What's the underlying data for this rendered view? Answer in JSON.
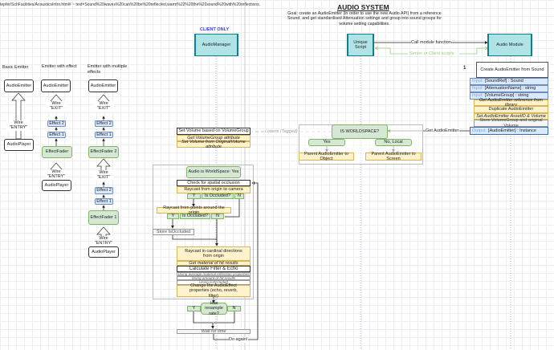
{
  "url_text": "tepfer/SchFacilities/AcousticsIntro.html# ~ text=Sound%20waves%20can%20be%20reflected,warm%22%20the%20sound%20with%20reflections.",
  "title": "AUDIO SYSTEM",
  "goal": "Goal: create an AudioEmitter (in order to use the new Audio API) from a reference Sound, and get standardised Attenuation settings and group into sound groups for volume setting capabilities.",
  "client_only": "CLIENT ONLY",
  "nodes": {
    "audio_manager": "AudioManager",
    "unique_script": "Unique Script",
    "audio_module": "Audio Module"
  },
  "edges": {
    "call_module": "Call module function",
    "server_client": "Server or Client scripts",
    "get_emitter": "Get AudioEmitter",
    "listens": "Listens (Tagged)",
    "do_again": "Do again!"
  },
  "emitters": {
    "basic": {
      "title": "Basic Emitter",
      "emitter": "AudioEmitter",
      "wire": "Wire\n\"ENTRY\"",
      "player": "AudioPlayer"
    },
    "effect": {
      "title": "Emitter with effect",
      "emitter": "AudioEmitter",
      "wire_exit": "Wire\n\"EXIT\"",
      "effect2": "Effect 2",
      "effect1": "Effect 1",
      "fader": "EffectFader",
      "wire_entry": "Wire\n\"ENTRY\"",
      "player": "AudioPlayer"
    },
    "multiple": {
      "title": "Emitter with multiple effects",
      "emitter": "AudioEmitter",
      "wire_exit": "Wire\n\"EXIT\"",
      "effect2a": "Effect 2",
      "effect1a": "Effect 1",
      "fader2": "EffectFader 2",
      "wire_exit2": "Wire\n\"EXIT\"",
      "effect2b": "Effect 2",
      "effect1b": "Effect 1",
      "fader1": "EffectFader 1",
      "wire_entry": "Wire\n\"ENTRY\"",
      "player": "AudioPlayer"
    }
  },
  "module": {
    "number": "1",
    "header": "Create AudioEmitter from Sound",
    "inputs": [
      {
        "label": "Input:",
        "text": "[SoundRef] : Sound"
      },
      {
        "label": "Input:",
        "text": "[AttenuationName] : string"
      },
      {
        "label": "Input:",
        "text": "[VolumeGroup] : string"
      }
    ],
    "steps": [
      "Get AudioEmitter reference from library",
      "Duplicate AudioEmitter",
      "Set AudioEmitter AssetID & Volume"
    ],
    "store": "Store VolumeGroup and original Volume",
    "output": {
      "label": "Output:",
      "text": "[AudioEmitter] : Instance"
    }
  },
  "worldspace": {
    "question": "IS WORLDSPACE?",
    "yes": "Yes",
    "no": "No, Local",
    "yes_action": "Parent AudioEmitter to Object",
    "no_action": "Parent AudioEmitter to Screen"
  },
  "volume": {
    "header": "Set Volume based on VolumeGroup",
    "step1": "Get VolumeGroup attribute",
    "step2": "Set Volume from OriginalVolume attribute"
  },
  "occlusion": {
    "start": "Audio is WorldSpace: Yes",
    "check": "Check for spatial occlusion",
    "ray1": "Raycast from origin to camera",
    "y": "Y",
    "n": "N",
    "occluded": "Is Occluded?",
    "ray2": "Raycast from points around the origin",
    "store": "Store IsOccluded",
    "ray3": "Raycast in cardinal directions from origin",
    "material": "Get material of hit results",
    "calc": "Calculate Filter & Echo",
    "using1": "Using average material reflection properties",
    "using2": "Using amount of hit results",
    "using3": "Using IsOccluded",
    "change": "Change the AudioEffect properties (echo, reverb, filter)",
    "resample": "Has resample rate?",
    "wait": "Wait for time"
  },
  "colors": {
    "teal": "#b0e3e6",
    "blue": "#dae8fc",
    "green": "#d5e8d4",
    "yellow": "#fff2cc",
    "client_only": "#3333ff",
    "server_client": "#97d077"
  }
}
